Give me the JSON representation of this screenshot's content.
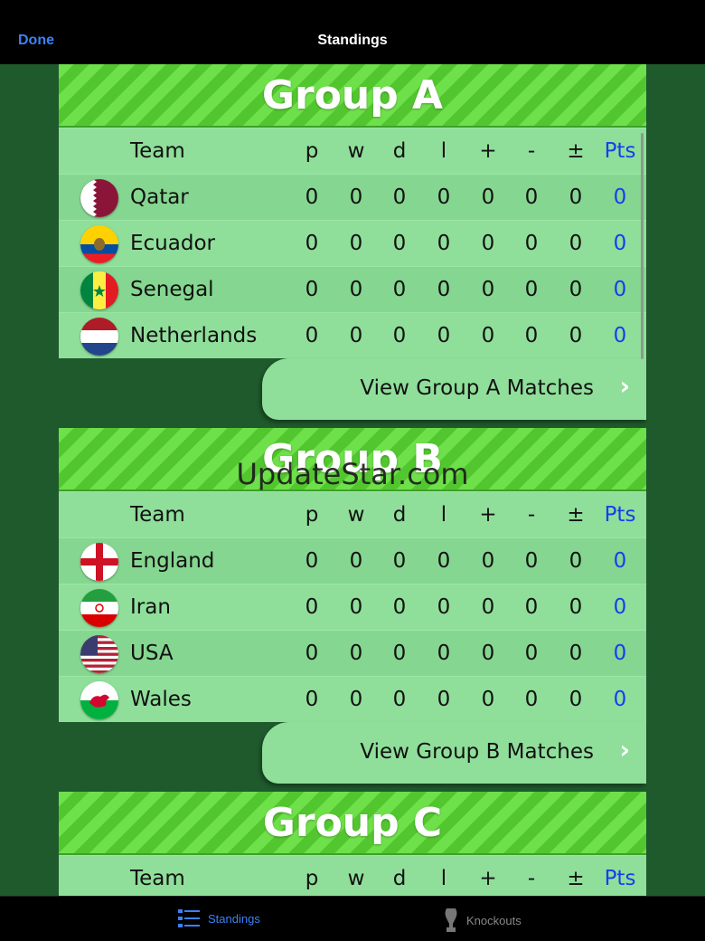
{
  "nav": {
    "done_label": "Done",
    "title": "Standings"
  },
  "columns": {
    "team": "Team",
    "p": "p",
    "w": "w",
    "d": "d",
    "l": "l",
    "plus": "+",
    "minus": "-",
    "diff": "±",
    "pts": "Pts"
  },
  "groups": [
    {
      "name": "Group A",
      "matches_label": "View Group A Matches",
      "teams": [
        {
          "name": "Qatar",
          "p": "0",
          "w": "0",
          "d": "0",
          "l": "0",
          "gf": "0",
          "ga": "0",
          "gd": "0",
          "pts": "0"
        },
        {
          "name": "Ecuador",
          "p": "0",
          "w": "0",
          "d": "0",
          "l": "0",
          "gf": "0",
          "ga": "0",
          "gd": "0",
          "pts": "0"
        },
        {
          "name": "Senegal",
          "p": "0",
          "w": "0",
          "d": "0",
          "l": "0",
          "gf": "0",
          "ga": "0",
          "gd": "0",
          "pts": "0"
        },
        {
          "name": "Netherlands",
          "p": "0",
          "w": "0",
          "d": "0",
          "l": "0",
          "gf": "0",
          "ga": "0",
          "gd": "0",
          "pts": "0"
        }
      ]
    },
    {
      "name": "Group B",
      "matches_label": "View Group B Matches",
      "teams": [
        {
          "name": "England",
          "p": "0",
          "w": "0",
          "d": "0",
          "l": "0",
          "gf": "0",
          "ga": "0",
          "gd": "0",
          "pts": "0"
        },
        {
          "name": "Iran",
          "p": "0",
          "w": "0",
          "d": "0",
          "l": "0",
          "gf": "0",
          "ga": "0",
          "gd": "0",
          "pts": "0"
        },
        {
          "name": "USA",
          "p": "0",
          "w": "0",
          "d": "0",
          "l": "0",
          "gf": "0",
          "ga": "0",
          "gd": "0",
          "pts": "0"
        },
        {
          "name": "Wales",
          "p": "0",
          "w": "0",
          "d": "0",
          "l": "0",
          "gf": "0",
          "ga": "0",
          "gd": "0",
          "pts": "0"
        }
      ]
    },
    {
      "name": "Group C"
    }
  ],
  "watermark": "UpdateStar.com",
  "tabbar": {
    "standings_label": "Standings",
    "knockouts_label": "Knockouts"
  },
  "colors": {
    "accent": "#3b82f6",
    "pts": "#1a3cf0",
    "row": "#8fdf9a",
    "header_stripe": "#6ee04a",
    "background": "#1e5a2c"
  }
}
